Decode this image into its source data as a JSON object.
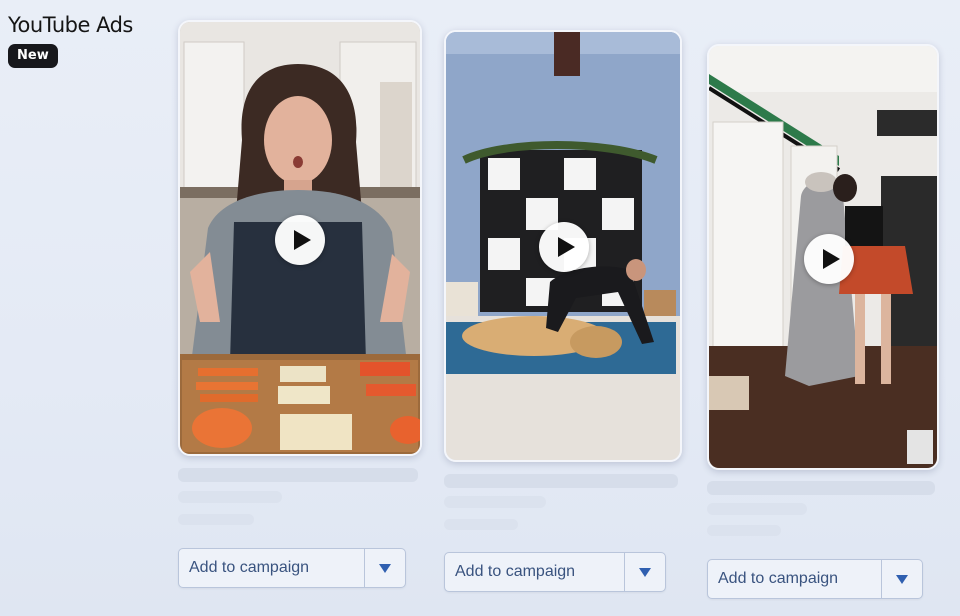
{
  "brand": {
    "title": "YouTube Ads",
    "badge": "New"
  },
  "colors": {
    "accent_text": "#39537f",
    "dropdown_arrow": "#2f5fb0",
    "badge_bg": "#17181c"
  },
  "icons": {
    "play": "play-icon",
    "dropdown": "chevron-down-icon"
  },
  "videos": [
    {
      "thumbnail": "woman-cooking-vegetables",
      "action_label": "Add to campaign"
    },
    {
      "thumbnail": "yoga-with-dog",
      "action_label": "Add to campaign"
    },
    {
      "thumbnail": "tailor-dress-form",
      "action_label": "Add to campaign"
    }
  ]
}
